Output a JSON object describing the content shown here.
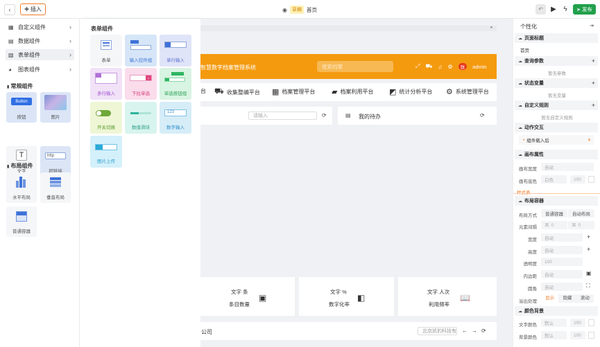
{
  "toolbar": {
    "insert_label": "插入",
    "status_badge": "草稿",
    "page_name": "首页",
    "publish_label": "发布"
  },
  "sidebar": {
    "categories": [
      {
        "label": "自定义组件",
        "icon": "puzzle-icon"
      },
      {
        "label": "数据组件",
        "icon": "database-icon"
      },
      {
        "label": "表单组件",
        "icon": "form-icon"
      },
      {
        "label": "图表组件",
        "icon": "pie-chart-icon"
      }
    ],
    "sections": [
      {
        "title": "常规组件",
        "items": [
          "按钮",
          "图片",
          "文字",
          "超链接"
        ]
      },
      {
        "title": "布局组件",
        "items": [
          "水平布局",
          "垂直布局",
          "普通容器"
        ]
      }
    ],
    "button_preview": "Button",
    "link_preview": "http",
    "text_preview": "T"
  },
  "flyout": {
    "title": "表单组件",
    "items": [
      "表单",
      "输入控件组",
      "单行输入",
      "多行输入",
      "下拉单选",
      "单选按钮组",
      "开关切换",
      "数值滑块",
      "数字输入",
      "图片上传"
    ],
    "number_preview": "123"
  },
  "canvas": {
    "header_title": "智慧数字档案管理系统",
    "search_placeholder": "搜索档案",
    "user_badge": "张",
    "user_name": "admin",
    "nav": [
      "台",
      "收集整编平台",
      "档案管理平台",
      "档案利用平台",
      "统计分析平台",
      "系统管理平台"
    ],
    "input_placeholder": "请输入",
    "todo_title": "我的待办",
    "stats": [
      {
        "line1": "文字  条",
        "line2": "条目数量",
        "icon": "chart-bar-icon"
      },
      {
        "line1": "文字  %",
        "line2": "数字化率",
        "icon": "video-icon"
      },
      {
        "line1": "文字  人次",
        "line2": "利用频率",
        "icon": "book-icon"
      }
    ],
    "footer_text": "公司",
    "footer_input": "北京凯豹科技有"
  },
  "panel": {
    "title": "个性化",
    "page_title_label": "页面标题",
    "page_title_value": "首页",
    "query_params_label": "查询参数",
    "query_params_empty": "暂无参数",
    "state_vars_label": "状态变量",
    "state_vars_empty": "暂无变量",
    "custom_rules_label": "自定义规则",
    "custom_rules_empty": "暂无自定义规则",
    "interaction_label": "动作交互",
    "on_load_label": "组件载入后",
    "canvas_props_label": "画布属性",
    "canvas_width_label": "画布宽度",
    "canvas_width_value": "自动",
    "canvas_color_label": "画布底色",
    "canvas_color_value": "白色",
    "canvas_opacity": "100",
    "stylesheet_label": "样式表",
    "layout_container_label": "布局容器",
    "layout_mode_label": "布局方式",
    "layout_mode_normal": "普通容器",
    "layout_mode_auto": "自动布局",
    "gap_label": "元素间隔",
    "gap_h": "0",
    "gap_v": "0",
    "width_label": "宽度",
    "width_value": "自动",
    "height_label": "高度",
    "height_value": "自动",
    "opacity_label": "透明度",
    "opacity_value": "100",
    "padding_label": "内边距",
    "padding_value": "自动",
    "radius_label": "圆角",
    "radius_value": "自动",
    "overflow_label": "溢出处理",
    "overflow_show": "显示",
    "overflow_hide": "隐藏",
    "overflow_scroll": "滚动",
    "color_bg_label": "颜色背景",
    "text_color_label": "文字颜色",
    "text_color_value": "默认",
    "text_color_opacity": "100",
    "bg_color_label": "背景颜色",
    "bg_color_value": "默认",
    "bg_color_opacity": "100"
  },
  "colors": {
    "accent_orange": "#f49a0f",
    "publish_green": "#22a04b",
    "insert_border": "#f07b2a"
  }
}
